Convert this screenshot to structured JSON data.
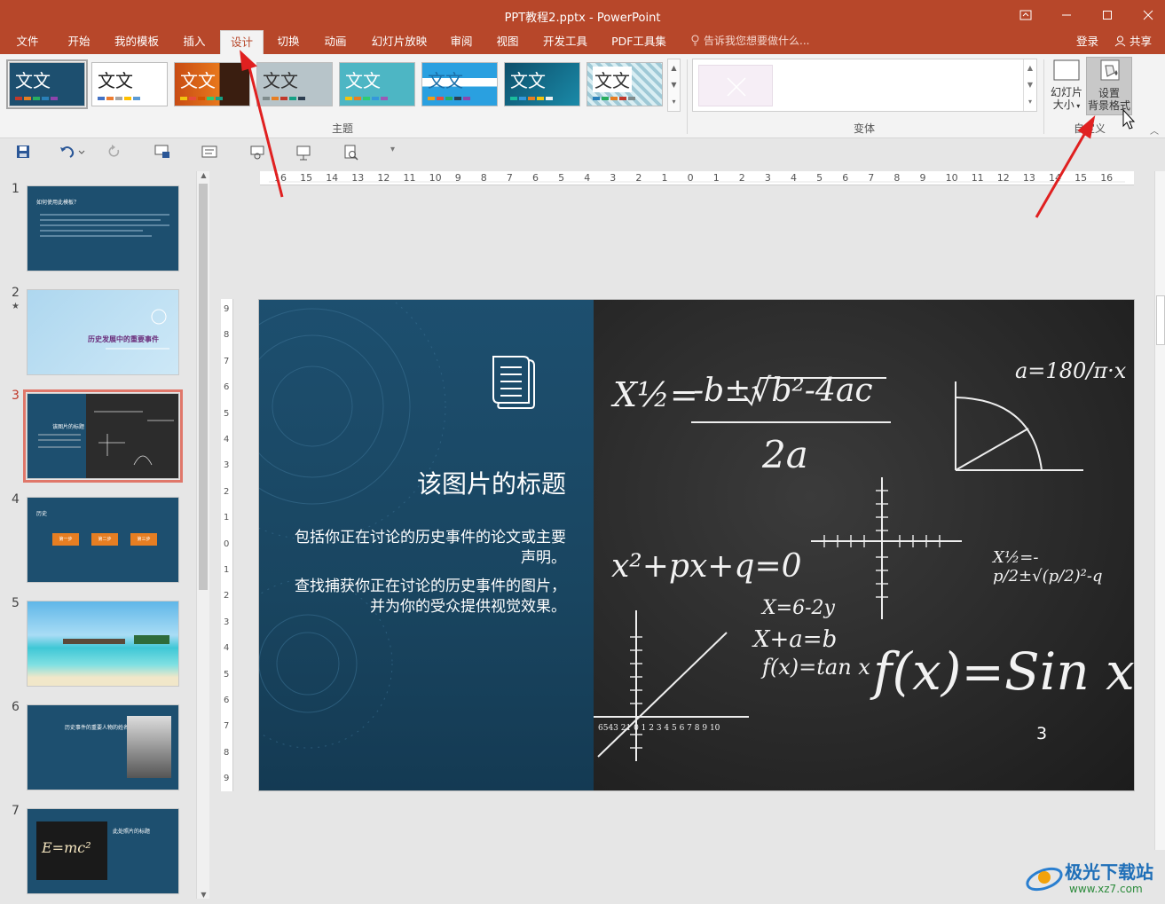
{
  "window": {
    "title": "PPT教程2.pptx - PowerPoint"
  },
  "tabs": [
    {
      "label": "文件"
    },
    {
      "label": "开始"
    },
    {
      "label": "我的模板"
    },
    {
      "label": "插入"
    },
    {
      "label": "设计"
    },
    {
      "label": "切换"
    },
    {
      "label": "动画"
    },
    {
      "label": "幻灯片放映"
    },
    {
      "label": "审阅"
    },
    {
      "label": "视图"
    },
    {
      "label": "开发工具"
    },
    {
      "label": "PDF工具集"
    }
  ],
  "active_tab": "设计",
  "tell_me": "告诉我您想要做什么...",
  "account": {
    "login": "登录",
    "share": "共享"
  },
  "ribbon": {
    "theme_sample_text": "文文",
    "themes_group_label": "主题",
    "variants_group_label": "变体",
    "customize_group_label": "自定义",
    "slide_size": {
      "line1": "幻灯片",
      "line2": "大小"
    },
    "format_background": {
      "line1": "设置",
      "line2": "背景格式"
    }
  },
  "thumbnails": [
    {
      "num": "1",
      "title": "如何使用此模板？"
    },
    {
      "num": "2",
      "title": "历史发展中的重要事件",
      "star": "★"
    },
    {
      "num": "3",
      "title": "该图片的标题"
    },
    {
      "num": "4",
      "title": "历史",
      "steps": [
        "第一步",
        "第二步",
        "第三步"
      ]
    },
    {
      "num": "5"
    },
    {
      "num": "6",
      "title": "历史事件的重要人物的姓名"
    },
    {
      "num": "7",
      "title": "此处照片的标题",
      "formula": "E=mc²"
    }
  ],
  "selected_slide": "3",
  "ruler": {
    "h_labels": [
      "16",
      "15",
      "14",
      "13",
      "12",
      "11",
      "10",
      "9",
      "8",
      "7",
      "6",
      "5",
      "4",
      "3",
      "2",
      "1",
      "0",
      "1",
      "2",
      "3",
      "4",
      "5",
      "6",
      "7",
      "8",
      "9",
      "10",
      "11",
      "12",
      "13",
      "14",
      "15",
      "16"
    ],
    "v_labels": [
      "9",
      "8",
      "7",
      "6",
      "5",
      "4",
      "3",
      "2",
      "1",
      "0",
      "1",
      "2",
      "3",
      "4",
      "5",
      "6",
      "7",
      "8",
      "9"
    ]
  },
  "slide": {
    "title": "该图片的标题",
    "body1": "包括你正在讨论的历史事件的论文或主要声明。",
    "body2": "查找捕获你正在讨论的历史事件的图片，并为你的受众提供视觉效果。",
    "page_number": "3",
    "chalk": {
      "quadratic": "-b±√b²-4ac",
      "denominator": "2a",
      "x_half": "X½=",
      "alpha": "a=180/π·x",
      "poly": "x²+px+q=0",
      "eq1": "X=6-2y",
      "eq2": "X+a=b",
      "eq3": "f(x)=tan x",
      "fx": "f(x)=Sin x",
      "xroot": "X½=-p/2±√(p/2)²-q",
      "axis_nums": "6543 21 0 1 2 3 4 5 6 7 8 9 10"
    }
  },
  "watermark": {
    "brand": "极光下载站",
    "url": "www.xz7.com"
  },
  "colors": {
    "accent": "#b7472a",
    "slide_blue": "#1d4f6f",
    "chalkboard": "#2a2a2a"
  }
}
